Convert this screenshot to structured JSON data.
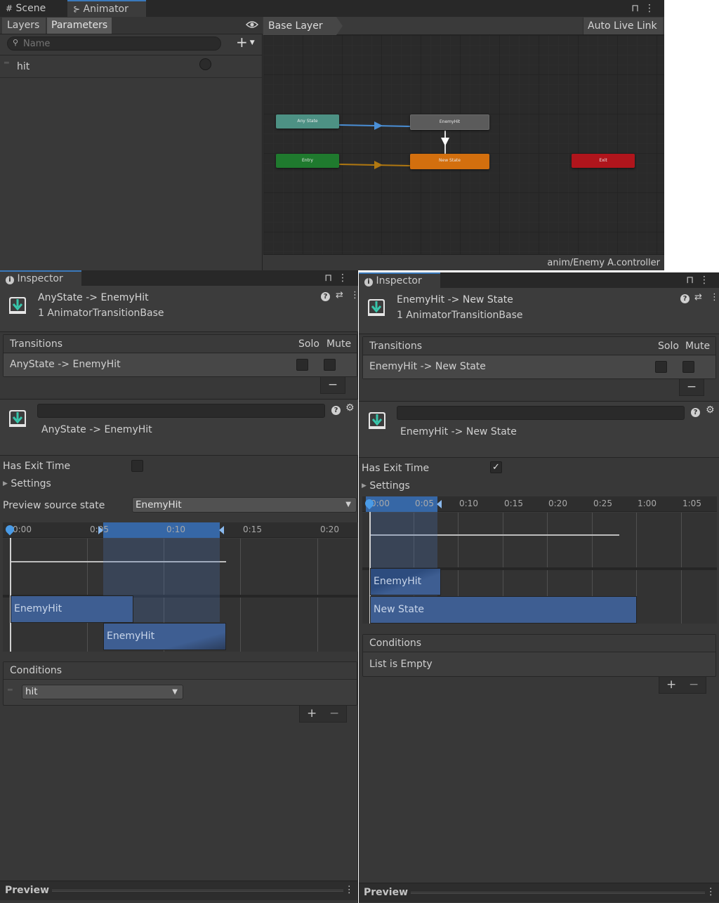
{
  "tabs": {
    "scene": "Scene",
    "animator": "Animator"
  },
  "left_tabs": {
    "layers": "Layers",
    "parameters": "Parameters"
  },
  "search": {
    "placeholder": "Name"
  },
  "parameter": {
    "name": "hit"
  },
  "graph": {
    "breadcrumb": "Base Layer",
    "live_link": "Auto Live Link",
    "controller_path": "anim/Enemy A.controller",
    "nodes": {
      "any_state": "Any State",
      "enemy_hit": "EnemyHit",
      "entry": "Entry",
      "new_state": "New State",
      "exit": "Exit"
    },
    "colors": {
      "any_state": "#4d9184",
      "entry": "#1f7a2e",
      "enemy_hit": "#5b5b5b",
      "new_state": "#d36f0e",
      "exit": "#b0151c",
      "transition_active": "#4a8fd6",
      "transition_entry": "#b07811"
    }
  },
  "inspector_left": {
    "tab": "Inspector",
    "title": "AnyState -> EnemyHit",
    "subtitle": "1 AnimatorTransitionBase",
    "transitions_header": "Transitions",
    "solo": "Solo",
    "mute": "Mute",
    "transition_row": "AnyState -> EnemyHit",
    "transition_name": "AnyState -> EnemyHit",
    "has_exit_time": "Has Exit Time",
    "has_exit_time_checked": false,
    "settings": "Settings",
    "preview_source_label": "Preview source state",
    "preview_source_value": "EnemyHit",
    "ticks": [
      "0:00",
      "0:05",
      "0:10",
      "0:15",
      "0:20"
    ],
    "clip_top": "EnemyHit",
    "clip_bottom": "EnemyHit",
    "conditions_header": "Conditions",
    "condition_param": "hit",
    "preview": "Preview"
  },
  "inspector_right": {
    "tab": "Inspector",
    "title": "EnemyHit -> New State",
    "subtitle": "1 AnimatorTransitionBase",
    "transitions_header": "Transitions",
    "solo": "Solo",
    "mute": "Mute",
    "transition_row": "EnemyHit -> New State",
    "transition_name": "EnemyHit -> New State",
    "has_exit_time": "Has Exit Time",
    "has_exit_time_checked": true,
    "check_glyph": "✓",
    "settings": "Settings",
    "ticks": [
      "0:00",
      "0:05",
      "0:10",
      "0:15",
      "0:20",
      "0:25",
      "1:00",
      "1:05"
    ],
    "clip_top": "EnemyHit",
    "clip_bottom": "New State",
    "conditions_header": "Conditions",
    "conditions_empty": "List is Empty",
    "preview": "Preview"
  },
  "icons": {
    "plus": "+",
    "minus": "−",
    "help": "?",
    "gear": "⚙",
    "menu": "⋮",
    "lock": "🔒",
    "eye": "👁",
    "search": "⚲",
    "triangle": "▶",
    "dropdown": "▼"
  }
}
